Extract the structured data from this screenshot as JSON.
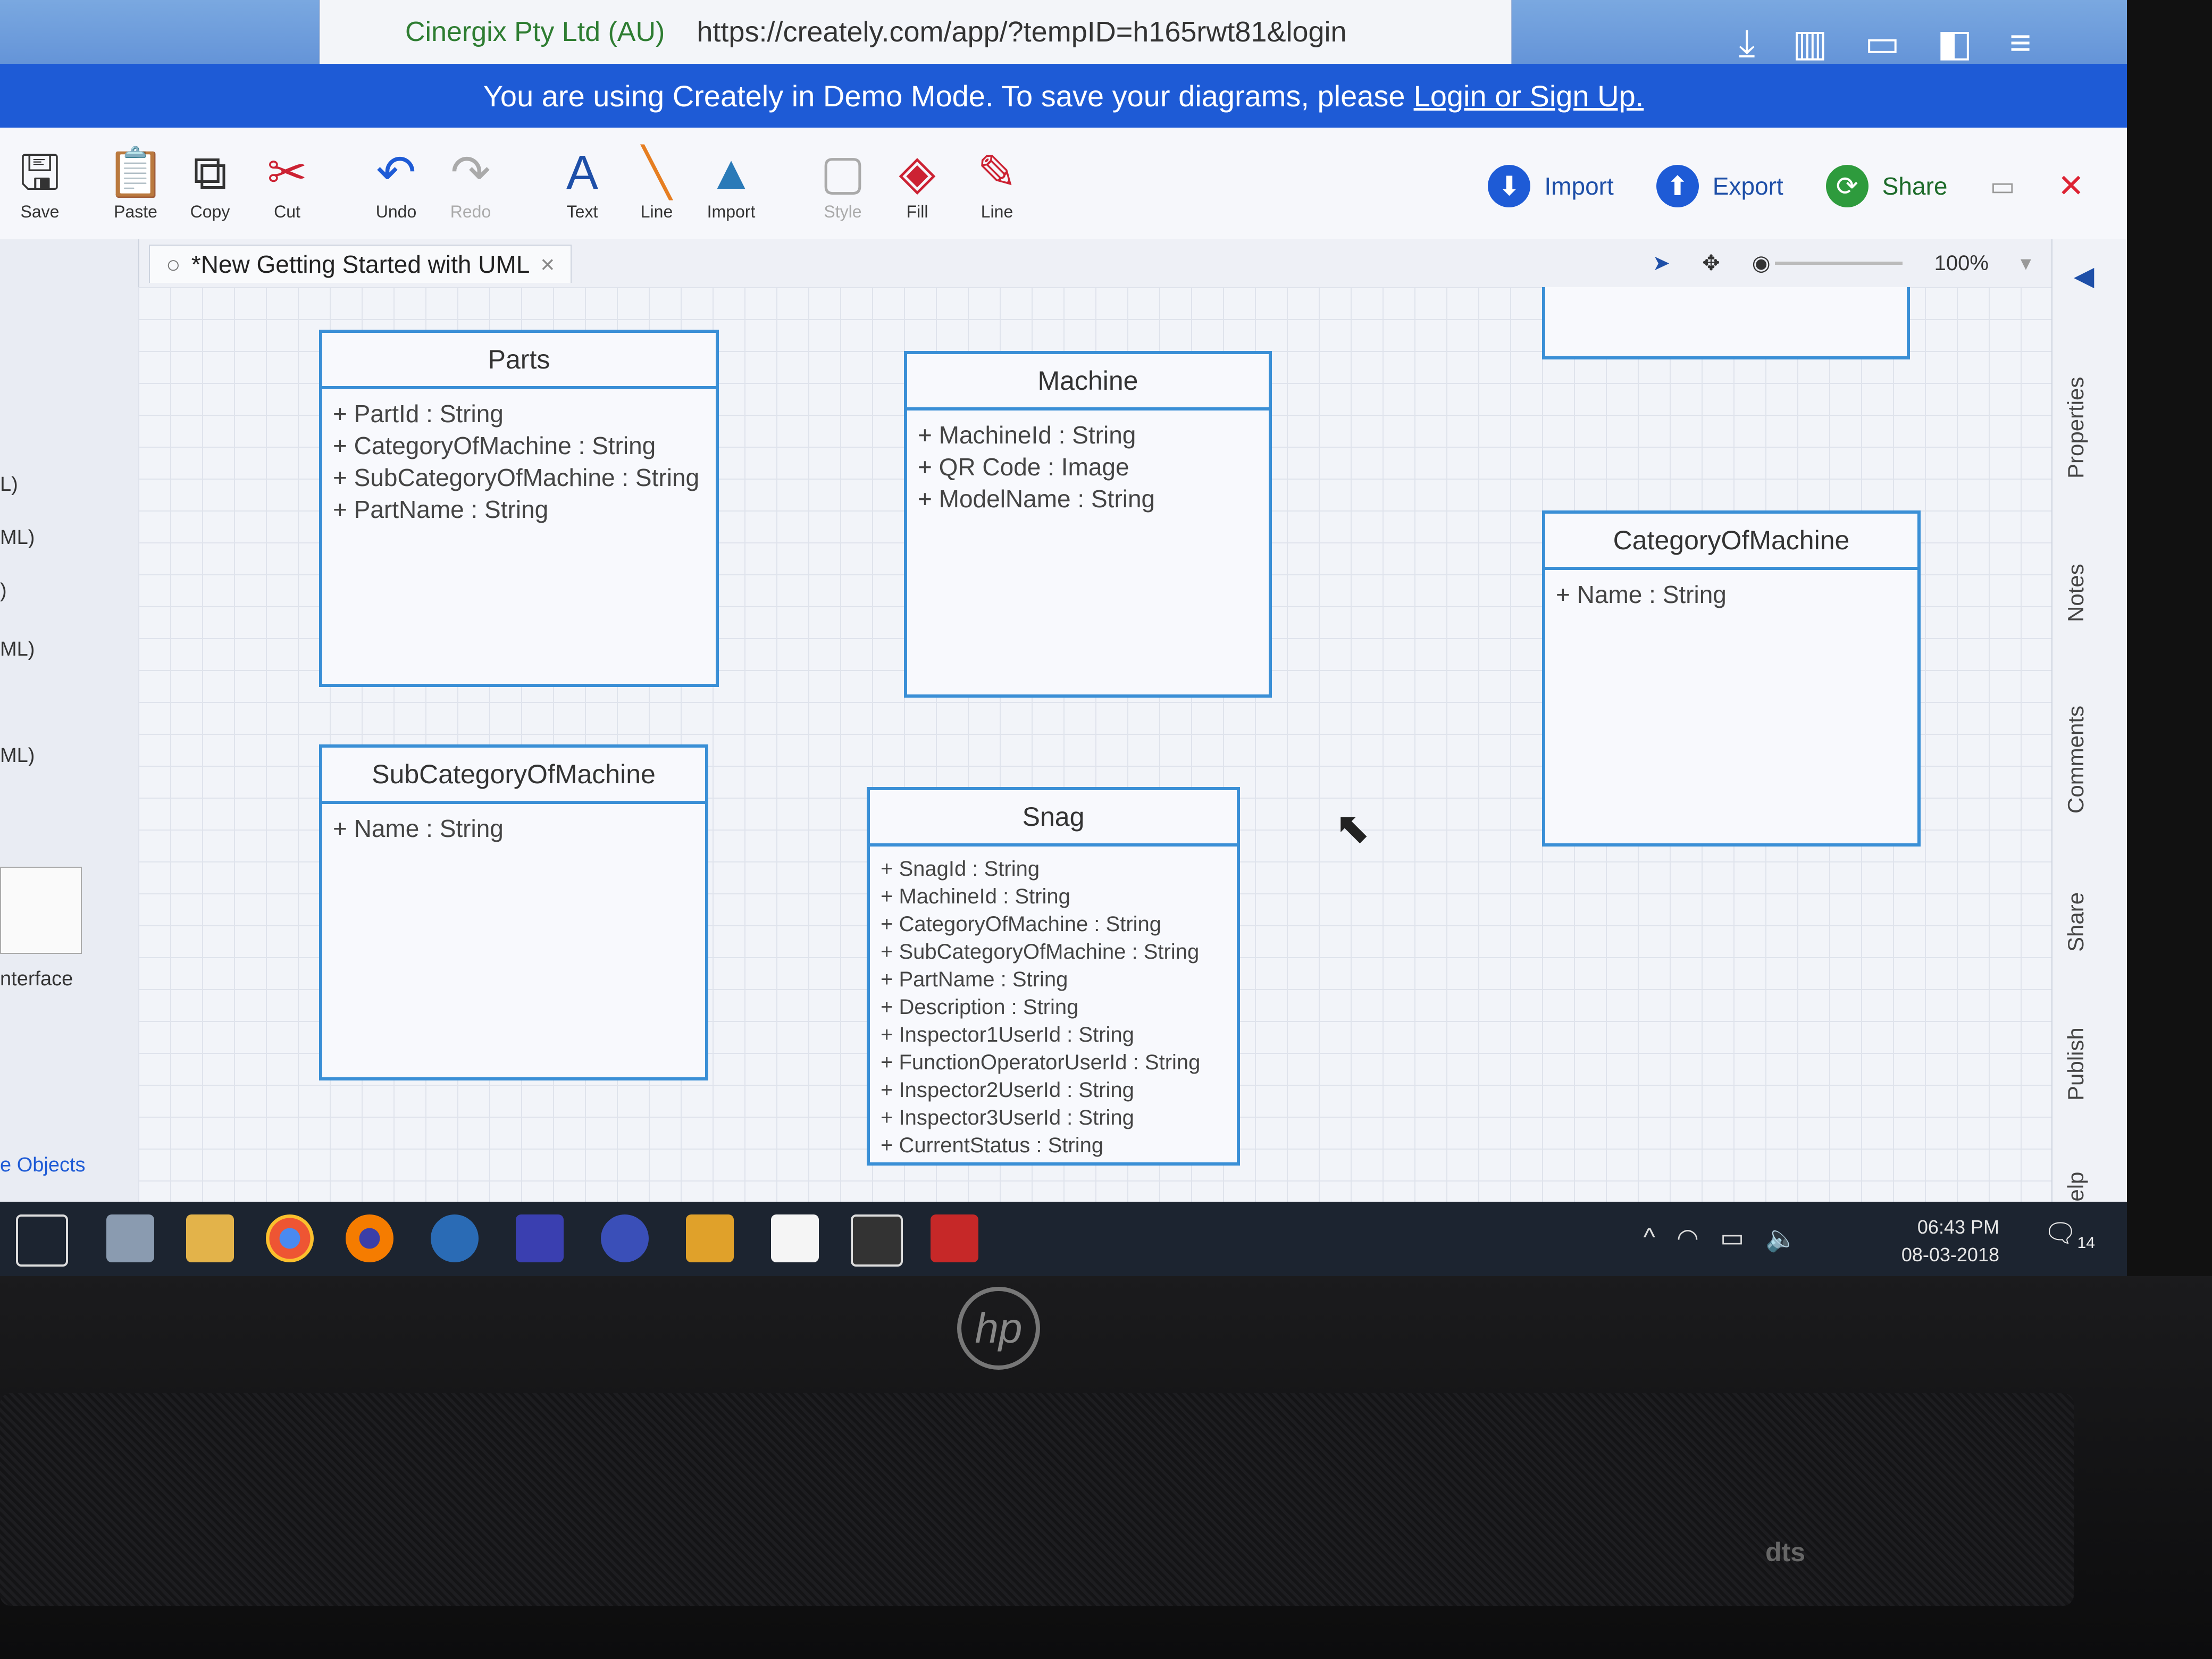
{
  "browser": {
    "site": "Cinergix Pty Ltd (AU)",
    "url": "https://creately.com/app/?tempID=h165rwt81&login"
  },
  "banner": {
    "message": "You are using Creately in Demo Mode. To save your diagrams, please",
    "link": "Login or Sign Up."
  },
  "toolbar": {
    "save": "Save",
    "paste": "Paste",
    "copy": "Copy",
    "cut": "Cut",
    "undo": "Undo",
    "redo": "Redo",
    "text": "Text",
    "line": "Line",
    "import": "Import",
    "style": "Style",
    "fill": "Fill",
    "line_color": "Line"
  },
  "actions": {
    "import": "Import",
    "export": "Export",
    "share": "Share"
  },
  "document": {
    "title": "*New Getting Started with UML",
    "zoom": "100%"
  },
  "left_panel": {
    "items": [
      "L)",
      "ML)",
      ")",
      "ML)",
      "ML)"
    ],
    "interface": "nterface",
    "more": "e Objects"
  },
  "classes": {
    "parts": {
      "name": "Parts",
      "attrs": [
        "+ PartId : String",
        "+ CategoryOfMachine : String",
        "+ SubCategoryOfMachine : String",
        "+ PartName : String"
      ]
    },
    "machine": {
      "name": "Machine",
      "attrs": [
        "+ MachineId : String",
        "+ QR Code : Image",
        "+ ModelName : String"
      ]
    },
    "category": {
      "name": "CategoryOfMachine",
      "attrs": [
        "+ Name : String"
      ]
    },
    "subcategory": {
      "name": "SubCategoryOfMachine",
      "attrs": [
        "+ Name : String"
      ]
    },
    "snag": {
      "name": "Snag",
      "attrs": [
        "+ SnagId : String",
        "+ MachineId : String",
        "+ CategoryOfMachine : String",
        "+ SubCategoryOfMachine : String",
        "+ PartName : String",
        "+ Description : String",
        "+ Inspector1UserId : String",
        "+ FunctionOperatorUserId : String",
        "+ Inspector2UserId : String",
        "+ Inspector3UserId : String",
        "+ CurrentStatus : String"
      ]
    }
  },
  "rail": {
    "properties": "Properties",
    "notes": "Notes",
    "comments": "Comments",
    "share": "Share",
    "publish": "Publish",
    "help": "Help"
  },
  "taskbar": {
    "time": "06:43 PM",
    "date": "08-03-2018",
    "notifications": "14"
  }
}
